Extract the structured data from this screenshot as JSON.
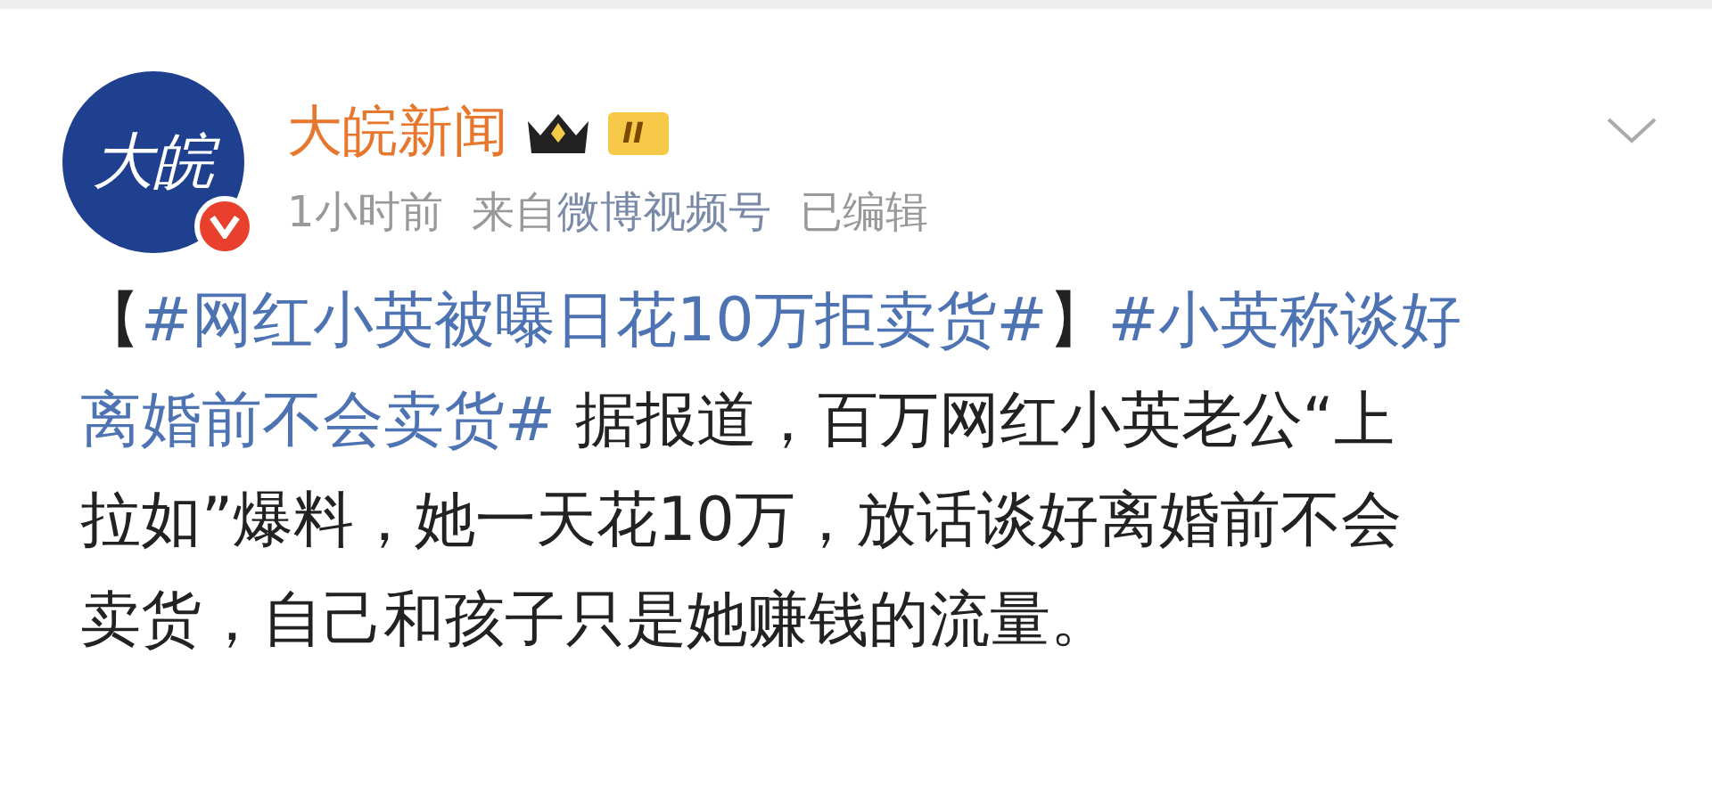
{
  "post": {
    "avatar_text": "大皖",
    "verified": true,
    "author": "大皖新闻",
    "level_badge": "II",
    "time": "1小时前",
    "source_prefix": "来自",
    "source": "微博视频号",
    "edited": "已编辑",
    "lines": [
      [
        {
          "kind": "text",
          "text": "【"
        },
        {
          "kind": "topic",
          "text": "#网红小英被曝日花10万拒卖货#"
        },
        {
          "kind": "text",
          "text": "】"
        },
        {
          "kind": "topic",
          "text": "#小英称谈好"
        }
      ],
      [
        {
          "kind": "topic",
          "text": "离婚前不会卖货#"
        },
        {
          "kind": "text",
          "text": " 据报道，百万网红小英老公“上"
        }
      ],
      [
        {
          "kind": "text",
          "text": "拉如”爆料，她一天花10万，放话谈好离婚前不会"
        }
      ],
      [
        {
          "kind": "text",
          "text": "卖货，自己和孩子只是她赚钱的流量。"
        }
      ]
    ]
  }
}
